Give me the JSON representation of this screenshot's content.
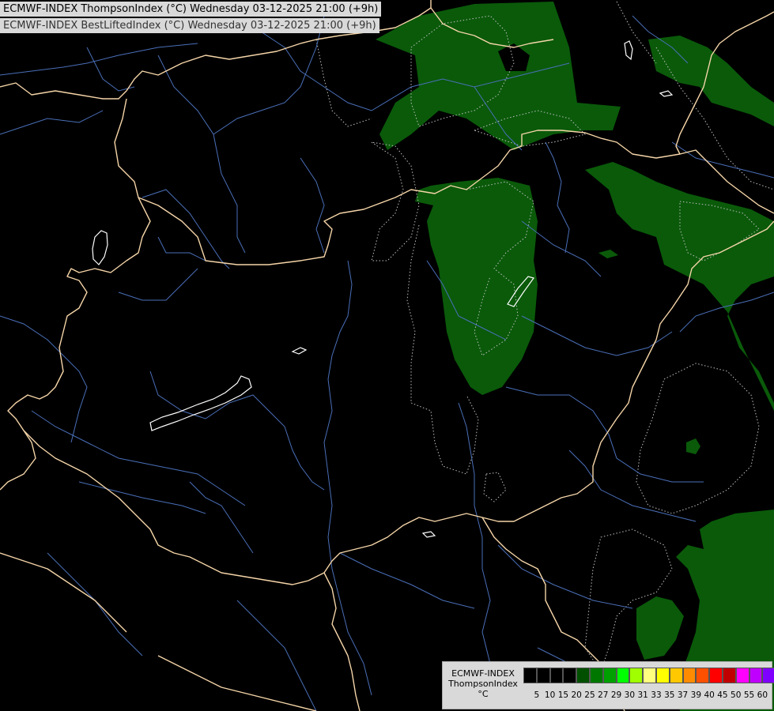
{
  "titles": {
    "line1": "ECMWF-INDEX ThompsonIndex (°C) Wednesday 03-12-2025 21:00 (+9h)",
    "line2": "ECMWF-INDEX BestLiftedIndex (°C) Wednesday 03-12-2025 21:00 (+9h)"
  },
  "legend": {
    "model": "ECMWF-INDEX",
    "parameter": "ThompsonIndex",
    "unit": "°C",
    "ticks": [
      "5",
      "10",
      "15",
      "20",
      "25",
      "27",
      "29",
      "30",
      "31",
      "33",
      "35",
      "37",
      "39",
      "40",
      "45",
      "50",
      "55",
      "60"
    ],
    "colors": [
      "#000000",
      "#000000",
      "#000000",
      "#000000",
      "#005000",
      "#007800",
      "#00a000",
      "#00ff00",
      "#a0ff00",
      "#ffff80",
      "#ffff00",
      "#ffc800",
      "#ff8c00",
      "#ff5000",
      "#ff0000",
      "#c00000",
      "#ff00ff",
      "#c000ff",
      "#8000ff",
      "#0000ff"
    ]
  },
  "map": {
    "background": "#000000",
    "border_color": "#f5d5a8",
    "river_color": "#4a6fb8",
    "area_fill": "#0a5a0a",
    "lake_outline": "#ffffff"
  },
  "map_icons": [
    "lake-outline-icon"
  ]
}
